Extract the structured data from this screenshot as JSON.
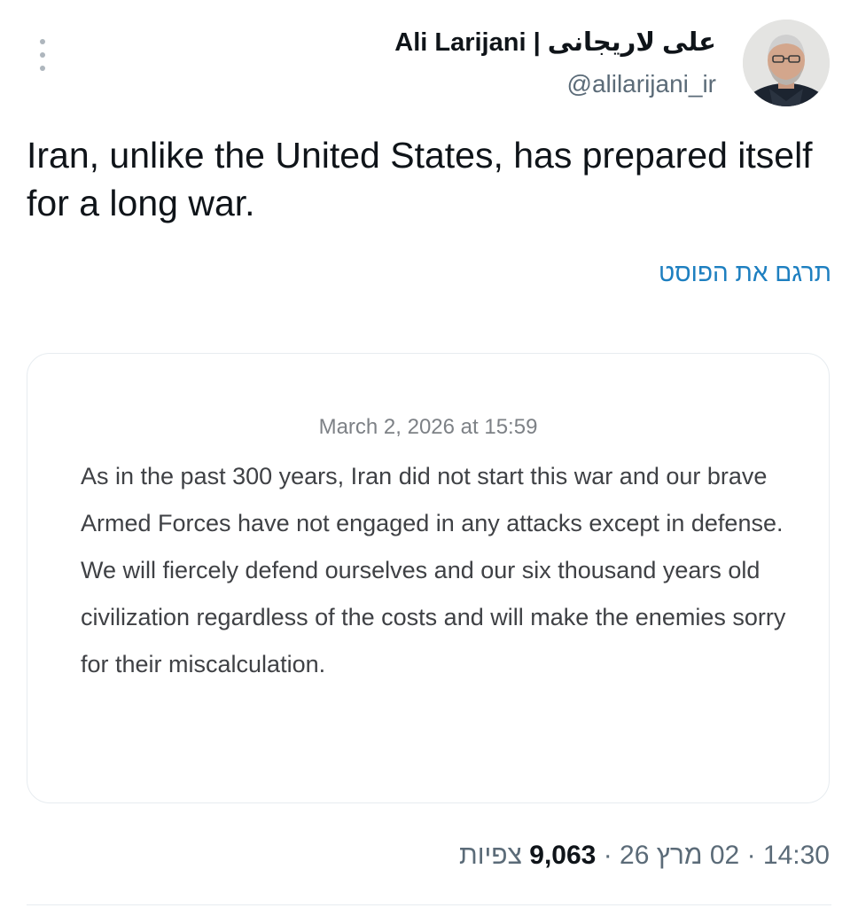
{
  "author": {
    "name": "Ali Larijani | علی لاریجانی",
    "handle": "@alilarijani_ir"
  },
  "post": {
    "text": "Iran, unlike the United States, has prepared itself for a long war.",
    "translate_label": "תרגם את הפוסט"
  },
  "quoted_card": {
    "date": "March 2, 2026 at 15:59",
    "body": "As in the past 300 years, Iran did not start this war and our brave Armed Forces have not engaged in any attacks except in defense. We will fiercely defend ourselves and our six thousand years old civilization regardless of the costs and will make the enemies sorry for their miscalculation."
  },
  "meta": {
    "time": "14:30",
    "date": "02 מרץ 26",
    "views_count": "9,063",
    "views_label": "צפיות",
    "separator": "·"
  },
  "icons": {
    "more": "vertical-ellipsis-icon",
    "avatar": "profile-photo"
  },
  "colors": {
    "link": "#1d7fc0",
    "secondary_text": "#5b6b78",
    "card_border": "#e7ecf0"
  }
}
